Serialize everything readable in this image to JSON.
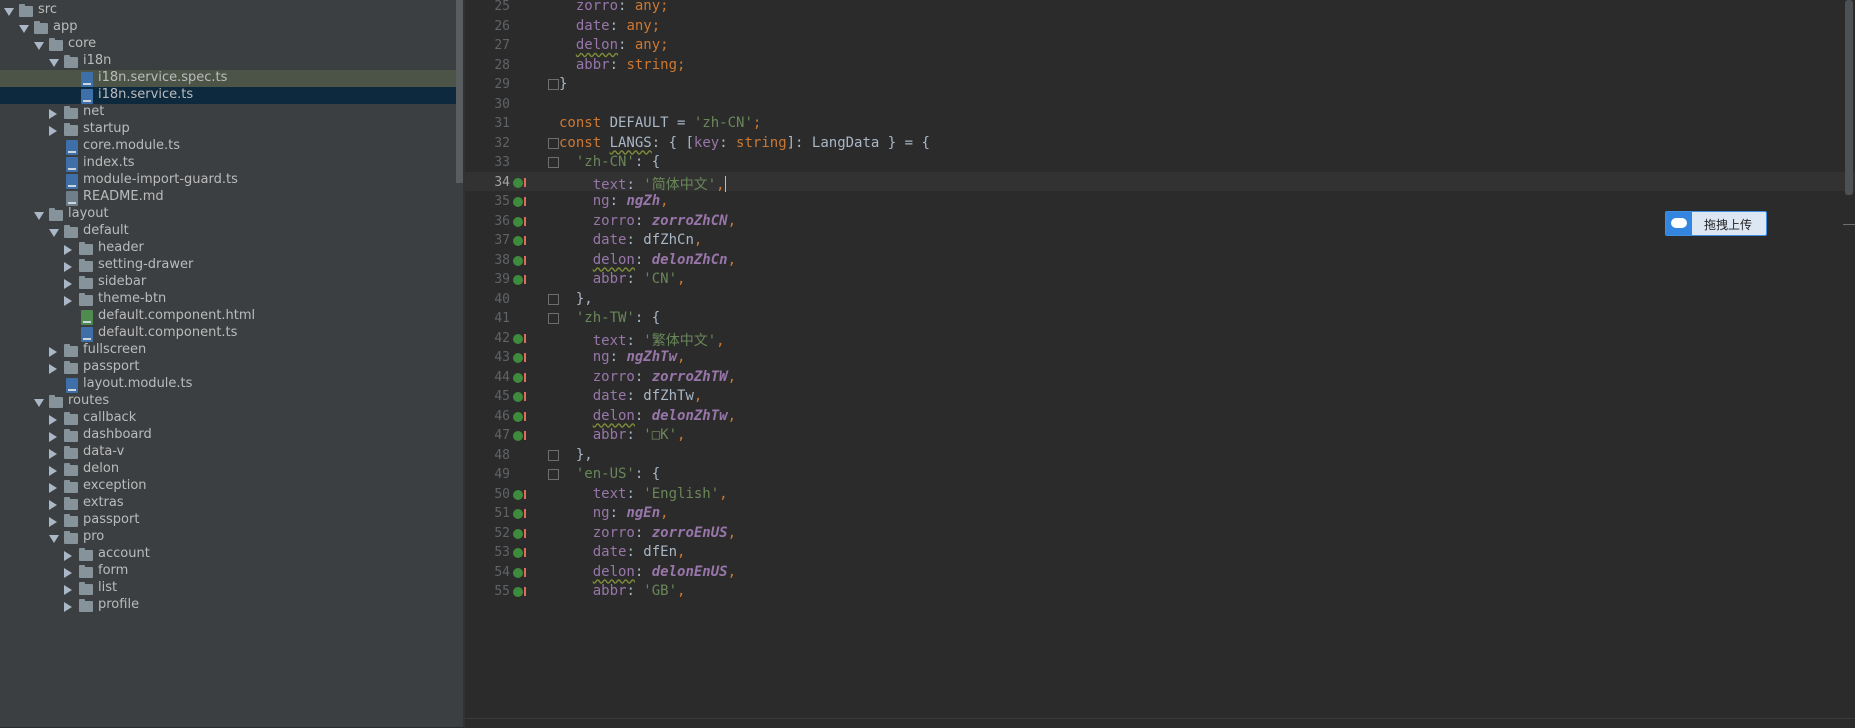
{
  "project_tree": {
    "rows": [
      {
        "label": "src",
        "type": "folder",
        "state": "open",
        "level": 0
      },
      {
        "label": "app",
        "type": "folder",
        "state": "open",
        "level": 1
      },
      {
        "label": "core",
        "type": "folder",
        "state": "open",
        "level": 2
      },
      {
        "label": "i18n",
        "type": "folder",
        "state": "open",
        "level": 3
      },
      {
        "label": "i18n.service.spec.ts",
        "type": "file",
        "ext": "ts",
        "level": 4,
        "highlight": "spec"
      },
      {
        "label": "i18n.service.ts",
        "type": "file",
        "ext": "ts",
        "level": 4,
        "highlight": "selected"
      },
      {
        "label": "net",
        "type": "folder",
        "state": "closed",
        "level": 3
      },
      {
        "label": "startup",
        "type": "folder",
        "state": "closed",
        "level": 3
      },
      {
        "label": "core.module.ts",
        "type": "file",
        "ext": "ts",
        "level": 3
      },
      {
        "label": "index.ts",
        "type": "file",
        "ext": "ts",
        "level": 3
      },
      {
        "label": "module-import-guard.ts",
        "type": "file",
        "ext": "ts",
        "level": 3
      },
      {
        "label": "README.md",
        "type": "file",
        "ext": "md",
        "level": 3
      },
      {
        "label": "layout",
        "type": "folder",
        "state": "open",
        "level": 2
      },
      {
        "label": "default",
        "type": "folder",
        "state": "open",
        "level": 3
      },
      {
        "label": "header",
        "type": "folder",
        "state": "closed",
        "level": 4
      },
      {
        "label": "setting-drawer",
        "type": "folder",
        "state": "closed",
        "level": 4
      },
      {
        "label": "sidebar",
        "type": "folder",
        "state": "closed",
        "level": 4
      },
      {
        "label": "theme-btn",
        "type": "folder",
        "state": "closed",
        "level": 4
      },
      {
        "label": "default.component.html",
        "type": "file",
        "ext": "html",
        "level": 4
      },
      {
        "label": "default.component.ts",
        "type": "file",
        "ext": "ts",
        "level": 4
      },
      {
        "label": "fullscreen",
        "type": "folder",
        "state": "closed",
        "level": 3
      },
      {
        "label": "passport",
        "type": "folder",
        "state": "closed",
        "level": 3
      },
      {
        "label": "layout.module.ts",
        "type": "file",
        "ext": "ts",
        "level": 3
      },
      {
        "label": "routes",
        "type": "folder",
        "state": "open",
        "level": 2
      },
      {
        "label": "callback",
        "type": "folder",
        "state": "closed",
        "level": 3
      },
      {
        "label": "dashboard",
        "type": "folder",
        "state": "closed",
        "level": 3
      },
      {
        "label": "data-v",
        "type": "folder",
        "state": "closed",
        "level": 3
      },
      {
        "label": "delon",
        "type": "folder",
        "state": "closed",
        "level": 3
      },
      {
        "label": "exception",
        "type": "folder",
        "state": "closed",
        "level": 3
      },
      {
        "label": "extras",
        "type": "folder",
        "state": "closed",
        "level": 3
      },
      {
        "label": "passport",
        "type": "folder",
        "state": "closed",
        "level": 3
      },
      {
        "label": "pro",
        "type": "folder",
        "state": "open",
        "level": 3
      },
      {
        "label": "account",
        "type": "folder",
        "state": "closed",
        "level": 4
      },
      {
        "label": "form",
        "type": "folder",
        "state": "closed",
        "level": 4
      },
      {
        "label": "list",
        "type": "folder",
        "state": "closed",
        "level": 4
      },
      {
        "label": "profile",
        "type": "folder",
        "state": "closed",
        "level": 4
      }
    ]
  },
  "editor": {
    "current_line": "34",
    "lines": [
      {
        "n": "25",
        "code": [
          [
            "  ",
            "t"
          ],
          [
            "zorro",
            "p"
          ],
          [
            ": ",
            "t"
          ],
          [
            "any",
            "k"
          ],
          [
            ";",
            "k"
          ]
        ]
      },
      {
        "n": "26",
        "code": [
          [
            "  ",
            "t"
          ],
          [
            "date",
            "p"
          ],
          [
            ": ",
            "t"
          ],
          [
            "any",
            "k"
          ],
          [
            ";",
            "k"
          ]
        ]
      },
      {
        "n": "27",
        "code": [
          [
            "  ",
            "t"
          ],
          [
            "delon",
            "pu"
          ],
          [
            ": ",
            "t"
          ],
          [
            "any",
            "k"
          ],
          [
            ";",
            "k"
          ]
        ]
      },
      {
        "n": "28",
        "code": [
          [
            "  ",
            "t"
          ],
          [
            "abbr",
            "p"
          ],
          [
            ": ",
            "t"
          ],
          [
            "string",
            "k"
          ],
          [
            ";",
            "k"
          ]
        ]
      },
      {
        "n": "29",
        "code": [
          [
            "}",
            "t"
          ]
        ],
        "fold": true
      },
      {
        "n": "30",
        "code": []
      },
      {
        "n": "31",
        "code": [
          [
            "const ",
            "k"
          ],
          [
            "DEFAULT = ",
            "t"
          ],
          [
            "'zh-CN'",
            "s"
          ],
          [
            ";",
            "k"
          ]
        ]
      },
      {
        "n": "32",
        "code": [
          [
            "const ",
            "k"
          ],
          [
            "LANGS",
            "tu"
          ],
          [
            ": { [",
            "t"
          ],
          [
            "key",
            "p"
          ],
          [
            ": ",
            "t"
          ],
          [
            "string",
            "k"
          ],
          [
            "]: LangData } = {",
            "t"
          ]
        ],
        "fold": true
      },
      {
        "n": "33",
        "code": [
          [
            "  ",
            "t"
          ],
          [
            "'zh-CN'",
            "s"
          ],
          [
            ": {",
            "t"
          ]
        ],
        "fold": true
      },
      {
        "n": "34",
        "code": [
          [
            "    ",
            "t"
          ],
          [
            "text",
            "p"
          ],
          [
            ": ",
            "t"
          ],
          [
            "'简体中文'",
            "s"
          ],
          [
            ",",
            "k"
          ]
        ],
        "gutter": true,
        "cursor": true
      },
      {
        "n": "35",
        "code": [
          [
            "    ",
            "t"
          ],
          [
            "ng",
            "p"
          ],
          [
            ": ",
            "t"
          ],
          [
            "ngZh",
            "i"
          ],
          [
            ",",
            "k"
          ]
        ],
        "gutter": true
      },
      {
        "n": "36",
        "code": [
          [
            "    ",
            "t"
          ],
          [
            "zorro",
            "p"
          ],
          [
            ": ",
            "t"
          ],
          [
            "zorroZhCN",
            "i"
          ],
          [
            ",",
            "k"
          ]
        ],
        "gutter": true
      },
      {
        "n": "37",
        "code": [
          [
            "    ",
            "t"
          ],
          [
            "date",
            "p"
          ],
          [
            ": ",
            "t"
          ],
          [
            "dfZhCn",
            "t"
          ],
          [
            ",",
            "k"
          ]
        ],
        "gutter": true
      },
      {
        "n": "38",
        "code": [
          [
            "    ",
            "t"
          ],
          [
            "delon",
            "pu"
          ],
          [
            ": ",
            "t"
          ],
          [
            "delonZhCn",
            "i"
          ],
          [
            ",",
            "k"
          ]
        ],
        "gutter": true
      },
      {
        "n": "39",
        "code": [
          [
            "    ",
            "t"
          ],
          [
            "abbr",
            "p"
          ],
          [
            ": ",
            "t"
          ],
          [
            "'CN'",
            "s"
          ],
          [
            ",",
            "k"
          ]
        ],
        "gutter": true
      },
      {
        "n": "40",
        "code": [
          [
            "  ",
            "t"
          ],
          [
            "},",
            "t"
          ]
        ],
        "fold": true
      },
      {
        "n": "41",
        "code": [
          [
            "  ",
            "t"
          ],
          [
            "'zh-TW'",
            "s"
          ],
          [
            ": {",
            "t"
          ]
        ],
        "fold": true
      },
      {
        "n": "42",
        "code": [
          [
            "    ",
            "t"
          ],
          [
            "text",
            "p"
          ],
          [
            ": ",
            "t"
          ],
          [
            "'繁体中文'",
            "s"
          ],
          [
            ",",
            "k"
          ]
        ],
        "gutter": true
      },
      {
        "n": "43",
        "code": [
          [
            "    ",
            "t"
          ],
          [
            "ng",
            "p"
          ],
          [
            ": ",
            "t"
          ],
          [
            "ngZhTw",
            "i"
          ],
          [
            ",",
            "k"
          ]
        ],
        "gutter": true
      },
      {
        "n": "44",
        "code": [
          [
            "    ",
            "t"
          ],
          [
            "zorro",
            "p"
          ],
          [
            ": ",
            "t"
          ],
          [
            "zorroZhTW",
            "i"
          ],
          [
            ",",
            "k"
          ]
        ],
        "gutter": true
      },
      {
        "n": "45",
        "code": [
          [
            "    ",
            "t"
          ],
          [
            "date",
            "p"
          ],
          [
            ": ",
            "t"
          ],
          [
            "dfZhTw",
            "t"
          ],
          [
            ",",
            "k"
          ]
        ],
        "gutter": true
      },
      {
        "n": "46",
        "code": [
          [
            "    ",
            "t"
          ],
          [
            "delon",
            "pu"
          ],
          [
            ": ",
            "t"
          ],
          [
            "delonZhTw",
            "i"
          ],
          [
            ",",
            "k"
          ]
        ],
        "gutter": true
      },
      {
        "n": "47",
        "code": [
          [
            "    ",
            "t"
          ],
          [
            "abbr",
            "p"
          ],
          [
            ": ",
            "t"
          ],
          [
            "'□K'",
            "s"
          ],
          [
            ",",
            "k"
          ]
        ],
        "gutter": true
      },
      {
        "n": "48",
        "code": [
          [
            "  ",
            "t"
          ],
          [
            "},",
            "t"
          ]
        ],
        "fold": true
      },
      {
        "n": "49",
        "code": [
          [
            "  ",
            "t"
          ],
          [
            "'en-US'",
            "s"
          ],
          [
            ": {",
            "t"
          ]
        ],
        "fold": true
      },
      {
        "n": "50",
        "code": [
          [
            "    ",
            "t"
          ],
          [
            "text",
            "p"
          ],
          [
            ": ",
            "t"
          ],
          [
            "'English'",
            "s"
          ],
          [
            ",",
            "k"
          ]
        ],
        "gutter": true
      },
      {
        "n": "51",
        "code": [
          [
            "    ",
            "t"
          ],
          [
            "ng",
            "p"
          ],
          [
            ": ",
            "t"
          ],
          [
            "ngEn",
            "i"
          ],
          [
            ",",
            "k"
          ]
        ],
        "gutter": true
      },
      {
        "n": "52",
        "code": [
          [
            "    ",
            "t"
          ],
          [
            "zorro",
            "p"
          ],
          [
            ": ",
            "t"
          ],
          [
            "zorroEnUS",
            "i"
          ],
          [
            ",",
            "k"
          ]
        ],
        "gutter": true
      },
      {
        "n": "53",
        "code": [
          [
            "    ",
            "t"
          ],
          [
            "date",
            "p"
          ],
          [
            ": ",
            "t"
          ],
          [
            "dfEn",
            "t"
          ],
          [
            ",",
            "k"
          ]
        ],
        "gutter": true
      },
      {
        "n": "54",
        "code": [
          [
            "    ",
            "t"
          ],
          [
            "delon",
            "pu"
          ],
          [
            ": ",
            "t"
          ],
          [
            "delonEnUS",
            "i"
          ],
          [
            ",",
            "k"
          ]
        ],
        "gutter": true
      },
      {
        "n": "55",
        "code": [
          [
            "    ",
            "t"
          ],
          [
            "abbr",
            "p"
          ],
          [
            ": ",
            "t"
          ],
          [
            "'GB'",
            "s"
          ],
          [
            ",",
            "k"
          ]
        ],
        "gutter": true
      }
    ]
  },
  "upload_widget": {
    "label": "拖拽上传",
    "icon": "baidu-cloud-icon"
  },
  "colors": {
    "keyword": "#cc7832",
    "property": "#9876aa",
    "string": "#6a8759",
    "default": "#a9b7c6",
    "selection": "#0d293e",
    "accent": "#3485e0"
  }
}
